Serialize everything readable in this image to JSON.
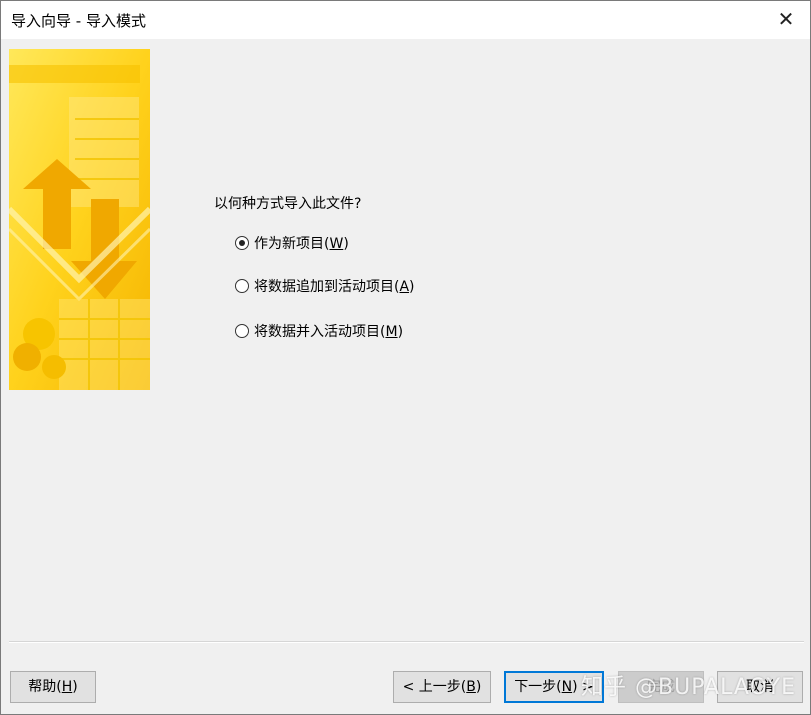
{
  "window": {
    "title": "导入向导 - 导入模式",
    "close_glyph": "✕"
  },
  "question": "以何种方式导入此文件?",
  "options": [
    {
      "label": "作为新项目(",
      "key": "W",
      "suffix": ")",
      "selected": true
    },
    {
      "label": "将数据追加到活动项目(",
      "key": "A",
      "suffix": ")",
      "selected": false
    },
    {
      "label": "将数据并入活动项目(",
      "key": "M",
      "suffix": ")",
      "selected": false
    }
  ],
  "buttons": {
    "help": {
      "label": "帮助(",
      "key": "H",
      "suffix": ")"
    },
    "back": {
      "label": "< 上一步(",
      "key": "B",
      "suffix": ")"
    },
    "next": {
      "label": "下一步(",
      "key": "N",
      "suffix": ") >"
    },
    "finish": {
      "label": "完成"
    },
    "cancel": {
      "label": "取消"
    }
  },
  "watermark": "知乎 @BUPALAOYE",
  "colors": {
    "banner_light": "#ffe24a",
    "banner_dark": "#f6b800",
    "accent": "#0078d7"
  }
}
